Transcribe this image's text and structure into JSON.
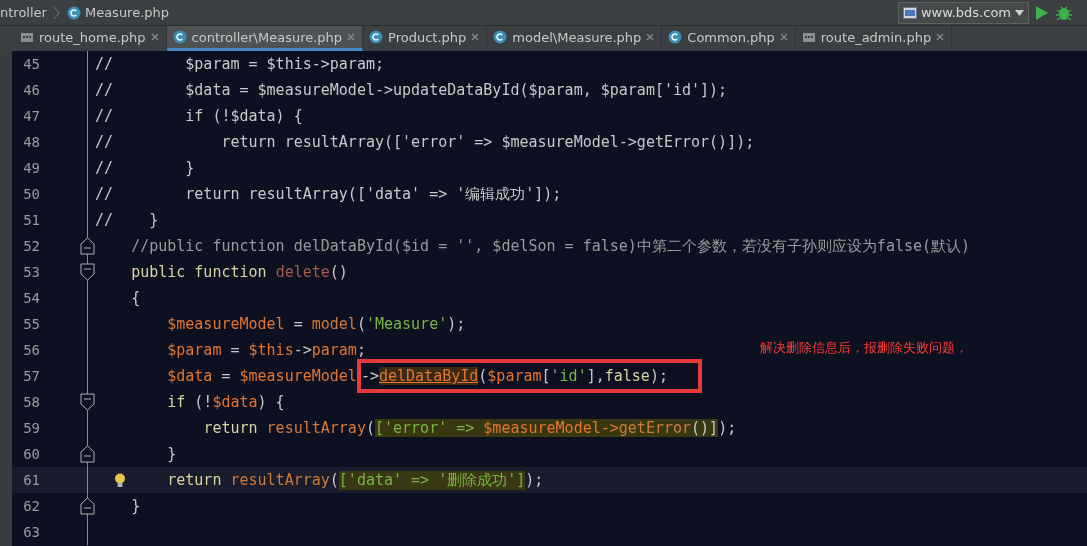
{
  "breadcrumb": [
    {
      "label": "ntroller",
      "kind": "plain"
    },
    {
      "label": "Measure.php",
      "kind": "class"
    }
  ],
  "run_config": {
    "label": "www.bds.com"
  },
  "tabs": [
    {
      "label": "route_home.php",
      "kind": "php",
      "selected": false
    },
    {
      "label": "controller\\Measure.php",
      "kind": "class",
      "selected": true
    },
    {
      "label": "Product.php",
      "kind": "class",
      "selected": false
    },
    {
      "label": "model\\Measure.php",
      "kind": "class",
      "selected": false
    },
    {
      "label": "Common.php",
      "kind": "class",
      "selected": false
    },
    {
      "label": "route_admin.php",
      "kind": "php",
      "selected": false
    }
  ],
  "lines": [
    {
      "number": "45",
      "tokens": [
        {
          "t": "//        $param = $this->param;",
          "kind": "disabled"
        }
      ]
    },
    {
      "number": "46",
      "tokens": [
        {
          "t": "//        $data = $measureModel->updateDataById($param, $param['id']);",
          "kind": "disabled"
        }
      ]
    },
    {
      "number": "47",
      "tokens": [
        {
          "t": "//        if (!$data) {",
          "kind": "disabled"
        }
      ]
    },
    {
      "number": "48",
      "tokens": [
        {
          "t": "//            return resultArray(['error' => $measureModel->getError()]);",
          "kind": "disabled"
        }
      ]
    },
    {
      "number": "49",
      "tokens": [
        {
          "t": "//        }",
          "kind": "disabled"
        }
      ]
    },
    {
      "number": "50",
      "tokens": [
        {
          "t": "//        return resultArray(['data' => '编辑成功']);",
          "kind": "disabled"
        }
      ]
    },
    {
      "number": "51",
      "tokens": [
        {
          "t": "//    }",
          "kind": "disabled"
        }
      ]
    },
    {
      "number": "52",
      "kind": "fold_end",
      "tokens": [
        {
          "t": "    //public function delDataById($id = '', $delSon = false)中第二个参数，若没有子孙则应设为false(默认)",
          "kind": "comment"
        }
      ]
    },
    {
      "number": "53",
      "kind": "fold_start",
      "tokens": [
        {
          "t": "    public function ",
          "kind": "keyword"
        },
        {
          "t": "delete",
          "kind": "name"
        },
        {
          "t": "()",
          "kind": "plain"
        }
      ]
    },
    {
      "number": "54",
      "tokens": [
        {
          "t": "    {",
          "kind": "plain"
        }
      ]
    },
    {
      "number": "55",
      "tokens": [
        {
          "t": "        $measureModel",
          "kind": "var"
        },
        {
          "t": " = ",
          "kind": "plain"
        },
        {
          "t": "model",
          "kind": "call"
        },
        {
          "t": "(",
          "kind": "plain"
        },
        {
          "t": "'Measure'",
          "kind": "string"
        },
        {
          "t": ");",
          "kind": "plain"
        }
      ]
    },
    {
      "number": "56",
      "note": "解决删除信息后，报删除失败问题，",
      "tokens": [
        {
          "t": "        $param",
          "kind": "var"
        },
        {
          "t": " = ",
          "kind": "plain"
        },
        {
          "t": "$this",
          "kind": "var"
        },
        {
          "t": "->",
          "kind": "plain"
        },
        {
          "t": "param",
          "kind": "var"
        },
        {
          "t": ";",
          "kind": "plain"
        }
      ]
    },
    {
      "number": "57",
      "tokens": [
        {
          "t": "        $data",
          "kind": "var"
        },
        {
          "t": " = ",
          "kind": "plain"
        },
        {
          "t": "$measureModel",
          "kind": "var"
        },
        {
          "kind": "boxed",
          "tokens": [
            {
              "t": "->",
              "kind": "plain"
            },
            {
              "t": "delDataById",
              "kind": "reference"
            },
            {
              "t": "(",
              "kind": "plain"
            },
            {
              "t": "$param",
              "kind": "var"
            },
            {
              "t": "[",
              "kind": "plain"
            },
            {
              "t": "'id'",
              "kind": "string"
            },
            {
              "t": "],",
              "kind": "plain"
            },
            {
              "t": "false",
              "kind": "keyword"
            },
            {
              "t": ");",
              "kind": "plain"
            }
          ]
        }
      ]
    },
    {
      "number": "58",
      "kind": "fold_start",
      "tokens": [
        {
          "t": "        if",
          "kind": "keyword"
        },
        {
          "t": " (!",
          "kind": "plain"
        },
        {
          "t": "$data",
          "kind": "var"
        },
        {
          "t": ") {",
          "kind": "plain"
        }
      ]
    },
    {
      "number": "59",
      "tokens": [
        {
          "t": "            return ",
          "kind": "keyword"
        },
        {
          "t": "resultArray",
          "kind": "call"
        },
        {
          "t": "(",
          "kind": "plain"
        },
        {
          "kind": "highlight",
          "tokens": [
            {
              "t": "['error' => ",
              "kind": "string"
            },
            {
              "t": "$measureModel->",
              "kind": "var"
            },
            {
              "t": "getError",
              "kind": "call"
            },
            {
              "t": "()]",
              "kind": "plain"
            }
          ]
        },
        {
          "t": ");",
          "kind": "plain"
        }
      ]
    },
    {
      "number": "60",
      "kind": "fold_end",
      "tokens": [
        {
          "t": "        }",
          "kind": "plain"
        }
      ]
    },
    {
      "number": "61",
      "current": true,
      "bulb": true,
      "tokens": [
        {
          "t": "        return ",
          "kind": "keyword"
        },
        {
          "t": "resultArray",
          "kind": "call"
        },
        {
          "t": "(",
          "kind": "plain"
        },
        {
          "kind": "highlight",
          "tokens": [
            {
              "t": "['data' => '删除成功']",
              "kind": "string"
            }
          ]
        },
        {
          "t": ");",
          "kind": "plain"
        }
      ]
    },
    {
      "number": "62",
      "kind": "fold_end",
      "tokens": [
        {
          "t": "    }",
          "kind": "plain"
        }
      ]
    },
    {
      "number": "63"
    }
  ]
}
